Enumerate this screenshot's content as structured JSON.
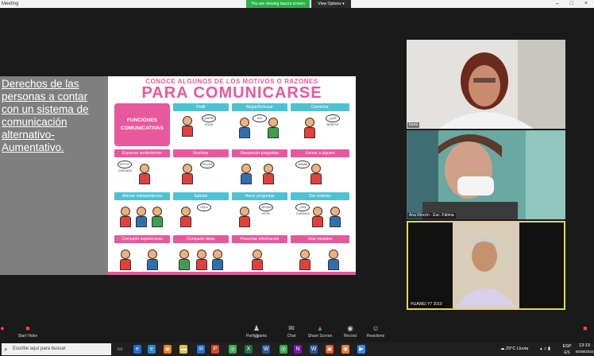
{
  "window": {
    "title": "Meeting",
    "controls": "– □ ×"
  },
  "banner": {
    "viewing": "You are viewing laura's screen",
    "view_options": "View Options ▾"
  },
  "slide": {
    "side_text": "Derechos de las personas a contar con un sistema de comunicación alternativo-Aumentativo.",
    "header_small": "CONOCE ALGUNOS DE LOS MOTIVOS O RAZONES",
    "header_big": "PARA COMUNICARSE",
    "box_label": "FUNCIONES COMUNICATIVAS",
    "row1": [
      "Pedir",
      "Negar/Rehusar",
      "Comentar"
    ],
    "row2": [
      "Expresar sentimientos",
      "Nombrar",
      "Responder preguntas",
      "Llamar a alguien"
    ],
    "row3": [
      "Afirmar independencia",
      "Saludar",
      "Hacer preguntas",
      "Dar órdenes"
    ],
    "row4": [
      "Compartir experiencias",
      "Compartir ideas",
      "Presentar información",
      "Usar modales"
    ],
    "bubbles": [
      "QUIERO AGUA",
      "NO!",
      "¿QUÉ BONITO!",
      "ESTOY CANSADO",
      "PELOTA",
      "¡MAMÁ!",
      "HOLA",
      "¿DÓNDE ESTÁ?",
      "¡TEN CUIDADO!"
    ]
  },
  "participants": [
    {
      "name": "laura"
    },
    {
      "name": "Ana Rincón - Esc. Fátima"
    },
    {
      "name": "HUAWEI Y7 2019"
    }
  ],
  "toolbar": {
    "start_video": "Start Video",
    "participants": "Participants",
    "participants_count": "12",
    "chat": "Chat",
    "share_screen": "Share Screen",
    "record": "Record",
    "reactions": "Reactions"
  },
  "taskbar": {
    "search_placeholder": "Escribe aquí para buscar",
    "weather": "29°C  Lluvia",
    "lang": "ESP ES",
    "time": "13:19",
    "date": "06/08/2020"
  }
}
